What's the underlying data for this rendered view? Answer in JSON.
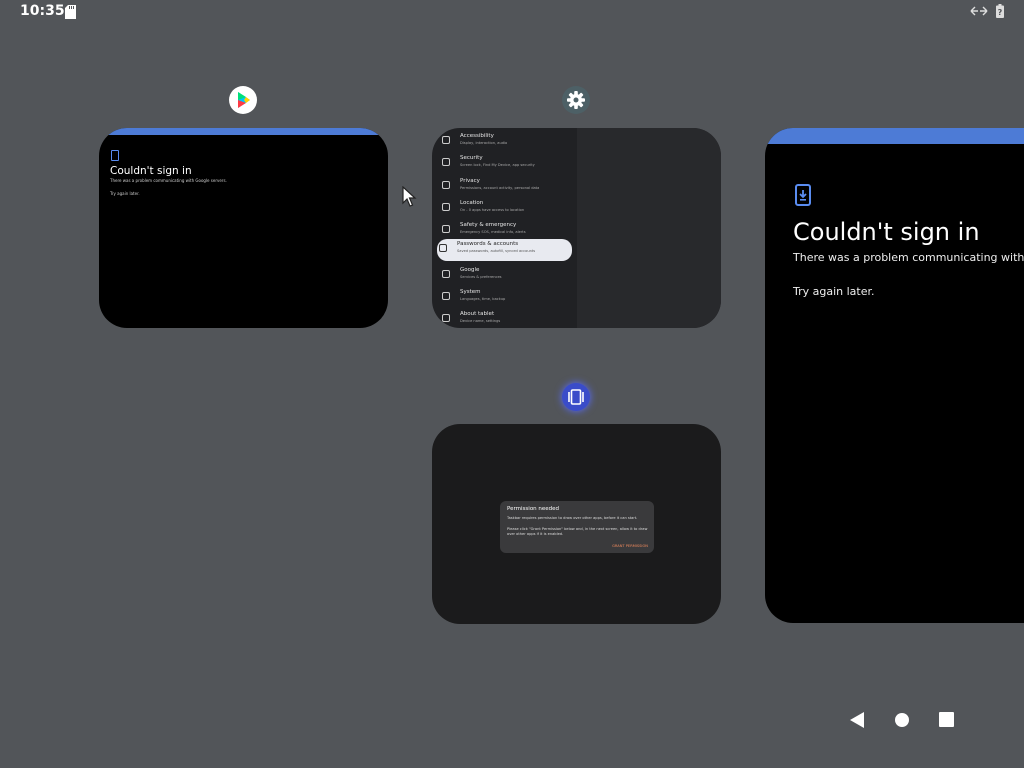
{
  "status_bar": {
    "time": "10:35",
    "sd_card_icon": "sd-card-icon",
    "rotate_icon": "swap-horizontal-icon",
    "battery_icon": "battery-unknown-icon"
  },
  "recents": {
    "play_store_card": {
      "app_icon": "google-play-icon",
      "title": "Couldn't sign in",
      "message": "There was a problem communicating with Google servers.",
      "retry": "Try again later."
    },
    "settings_card": {
      "app_icon": "gear-icon",
      "items": [
        {
          "title": "Accessibility",
          "subtitle": "Display, interaction, audio"
        },
        {
          "title": "Security",
          "subtitle": "Screen lock, Find My Device, app security"
        },
        {
          "title": "Privacy",
          "subtitle": "Permissions, account activity, personal data"
        },
        {
          "title": "Location",
          "subtitle": "On - 0 apps have access to location"
        },
        {
          "title": "Safety & emergency",
          "subtitle": "Emergency SOS, medical info, alerts"
        },
        {
          "title": "Passwords & accounts",
          "subtitle": "Saved passwords, autofill, synced accounts"
        },
        {
          "title": "Google",
          "subtitle": "Services & preferences"
        },
        {
          "title": "System",
          "subtitle": "Languages, time, backup"
        },
        {
          "title": "About tablet",
          "subtitle": "Device name, settings"
        }
      ],
      "active_index": 5
    },
    "permission_card": {
      "app_icon": "foldable-device-icon",
      "dialog_title": "Permission needed",
      "dialog_line1": "Taskbar requires permission to draw over other apps, before it can start.",
      "dialog_line2": "Please click \"Grant Permission\" below and, in the next screen, allow it to draw over other apps if it is enabled.",
      "dialog_button": "GRANT PERMISSION"
    },
    "big_card": {
      "title": "Couldn't sign in",
      "message": "There was a problem communicating with Go",
      "retry": "Try again later."
    }
  },
  "nav_bar": {
    "back": "back-triangle-icon",
    "home": "home-circle-icon",
    "recents": "recents-square-icon"
  },
  "colors": {
    "background": "#525559",
    "accent_blue": "#4d7bd6"
  }
}
